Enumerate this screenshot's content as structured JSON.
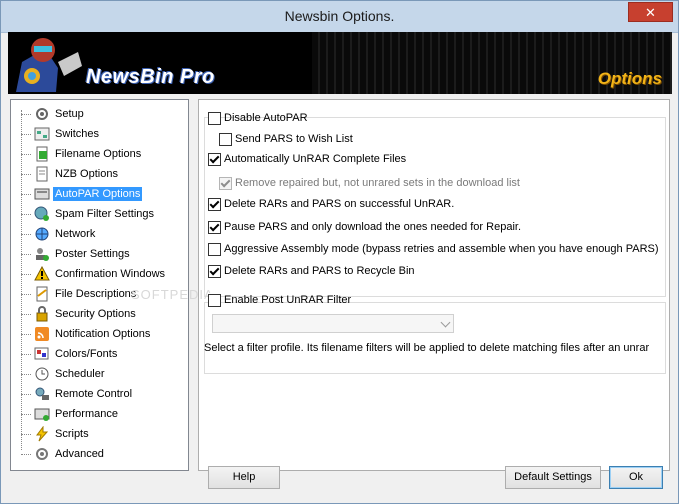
{
  "window": {
    "title": "Newsbin Options.",
    "close_glyph": "✕"
  },
  "banner": {
    "brand": "NewsBin Pro",
    "section": "Options"
  },
  "sidebar": {
    "items": [
      {
        "label": "Setup",
        "icon": "gear-icon"
      },
      {
        "label": "Switches",
        "icon": "switches-icon"
      },
      {
        "label": "Filename Options",
        "icon": "filename-icon"
      },
      {
        "label": "NZB Options",
        "icon": "nzb-file-icon"
      },
      {
        "label": "AutoPAR Options",
        "icon": "autopar-icon",
        "selected": true
      },
      {
        "label": "Spam Filter Settings",
        "icon": "spam-filter-icon"
      },
      {
        "label": "Network",
        "icon": "network-icon"
      },
      {
        "label": "Poster Settings",
        "icon": "poster-icon"
      },
      {
        "label": "Confirmation Windows",
        "icon": "warning-icon"
      },
      {
        "label": "File Descriptions",
        "icon": "file-description-icon"
      },
      {
        "label": "Security Options",
        "icon": "security-icon"
      },
      {
        "label": "Notification Options",
        "icon": "rss-icon"
      },
      {
        "label": "Colors/Fonts",
        "icon": "colors-fonts-icon"
      },
      {
        "label": "Scheduler",
        "icon": "clock-icon"
      },
      {
        "label": "Remote Control",
        "icon": "remote-control-icon"
      },
      {
        "label": "Performance",
        "icon": "performance-icon"
      },
      {
        "label": "Scripts",
        "icon": "lightning-icon"
      },
      {
        "label": "Advanced",
        "icon": "advanced-gear-icon"
      }
    ]
  },
  "autopar": {
    "disable_autopar": {
      "label": "Disable AutoPAR",
      "checked": false
    },
    "send_pars_wishlist": {
      "label": "Send PARS to Wish List",
      "checked": false
    },
    "auto_unrar": {
      "label": "Automatically UnRAR Complete Files",
      "checked": true
    },
    "remove_repaired": {
      "label": "Remove repaired but, not unrared sets in the download list",
      "checked": true,
      "disabled": true
    },
    "delete_rars": {
      "label": "Delete RARs and PARS on successful UnRAR.",
      "checked": true
    },
    "pause_pars": {
      "label": "Pause PARS and only download the ones needed for Repair.",
      "checked": true
    },
    "aggressive_assembly": {
      "label": "Aggressive Assembly mode (bypass retries and assemble when you have enough PARS)",
      "checked": false
    },
    "recycle_bin": {
      "label": "Delete RARs and PARS to Recycle Bin",
      "checked": true
    },
    "enable_post_unrar": {
      "label": "Enable Post UnRAR Filter",
      "checked": false
    },
    "filter_profile_value": "",
    "filter_note": "Select a filter profile. Its filename filters will be applied to delete matching files after an unrar"
  },
  "buttons": {
    "help": "Help",
    "default_settings": "Default Settings",
    "ok": "Ok"
  },
  "colors": {
    "selection": "#3399ff",
    "titlebar": "#c5d7ea",
    "close": "#c7402f",
    "options_badge": "#f2b418"
  }
}
